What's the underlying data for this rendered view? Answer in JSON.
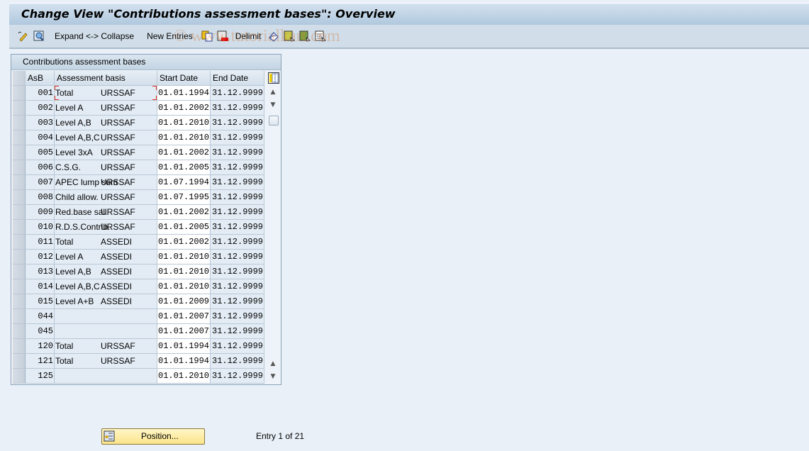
{
  "window": {
    "title": "Change View \"Contributions assessment bases\": Overview"
  },
  "toolbar": {
    "items": [
      {
        "type": "icon",
        "icon": "display-change-icon"
      },
      {
        "type": "icon",
        "icon": "find-icon"
      },
      {
        "type": "text",
        "label": "Expand <-> Collapse"
      },
      {
        "type": "text",
        "label": "New Entries"
      },
      {
        "type": "icon",
        "icon": "copy-icon"
      },
      {
        "type": "icon",
        "icon": "delete-icon"
      },
      {
        "type": "text",
        "label": "Delimit"
      },
      {
        "type": "icon",
        "icon": "undo-icon"
      },
      {
        "type": "icon",
        "icon": "select-all-icon"
      },
      {
        "type": "icon",
        "icon": "select-block-icon"
      },
      {
        "type": "icon",
        "icon": "deselect-all-icon"
      }
    ],
    "expand_label": "Expand <-> Collapse",
    "new_entries_label": "New Entries",
    "delimit_label": "Delimit",
    "watermark": "© www.tutorialkart.com"
  },
  "panel": {
    "title": "Contributions assessment bases",
    "columns": [
      "AsB",
      "Assessment basis",
      "Start Date",
      "End Date"
    ],
    "rows": [
      {
        "asb": "001",
        "basis": "Total",
        "fund": "URSSAF",
        "start": "01.01.1994",
        "end": "31.12.9999"
      },
      {
        "asb": "002",
        "basis": "Level A",
        "fund": "URSSAF",
        "start": "01.01.2002",
        "end": "31.12.9999"
      },
      {
        "asb": "003",
        "basis": "Level A,B",
        "fund": "URSSAF",
        "start": "01.01.2010",
        "end": "31.12.9999"
      },
      {
        "asb": "004",
        "basis": "Level A,B,C",
        "fund": "URSSAF",
        "start": "01.01.2010",
        "end": "31.12.9999"
      },
      {
        "asb": "005",
        "basis": "Level 3xA",
        "fund": "URSSAF",
        "start": "01.01.2002",
        "end": "31.12.9999"
      },
      {
        "asb": "006",
        "basis": "C.S.G.",
        "fund": "URSSAF",
        "start": "01.01.2005",
        "end": "31.12.9999"
      },
      {
        "asb": "007",
        "basis": "APEC lump sum",
        "fund": "URSSAF",
        "start": "01.07.1994",
        "end": "31.12.9999"
      },
      {
        "asb": "008",
        "basis": "Child allow.",
        "fund": "URSSAF",
        "start": "01.07.1995",
        "end": "31.12.9999"
      },
      {
        "asb": "009",
        "basis": "Red.base sal.",
        "fund": "URSSAF",
        "start": "01.01.2002",
        "end": "31.12.9999"
      },
      {
        "asb": "010",
        "basis": "R.D.S.Contrib.",
        "fund": "URSSAF",
        "start": "01.01.2005",
        "end": "31.12.9999"
      },
      {
        "asb": "011",
        "basis": "Total",
        "fund": "ASSEDI",
        "start": "01.01.2002",
        "end": "31.12.9999"
      },
      {
        "asb": "012",
        "basis": "Level A",
        "fund": "ASSEDI",
        "start": "01.01.2010",
        "end": "31.12.9999"
      },
      {
        "asb": "013",
        "basis": "Level A,B",
        "fund": "ASSEDI",
        "start": "01.01.2010",
        "end": "31.12.9999"
      },
      {
        "asb": "014",
        "basis": "Level A,B,C",
        "fund": "ASSEDI",
        "start": "01.01.2010",
        "end": "31.12.9999"
      },
      {
        "asb": "015",
        "basis": "Level A+B",
        "fund": "ASSEDI",
        "start": "01.01.2009",
        "end": "31.12.9999"
      },
      {
        "asb": "044",
        "basis": "",
        "fund": "",
        "start": "01.01.2007",
        "end": "31.12.9999"
      },
      {
        "asb": "045",
        "basis": "",
        "fund": "",
        "start": "01.01.2007",
        "end": "31.12.9999"
      },
      {
        "asb": "120",
        "basis": "Total",
        "fund": "URSSAF",
        "start": "01.01.1994",
        "end": "31.12.9999"
      },
      {
        "asb": "121",
        "basis": "Total",
        "fund": "URSSAF",
        "start": "01.01.1994",
        "end": "31.12.9999"
      },
      {
        "asb": "125",
        "basis": "",
        "fund": "",
        "start": "01.01.2010",
        "end": "31.12.9999"
      }
    ]
  },
  "footer": {
    "position_button": "Position...",
    "entry_info": "Entry 1 of 21"
  }
}
